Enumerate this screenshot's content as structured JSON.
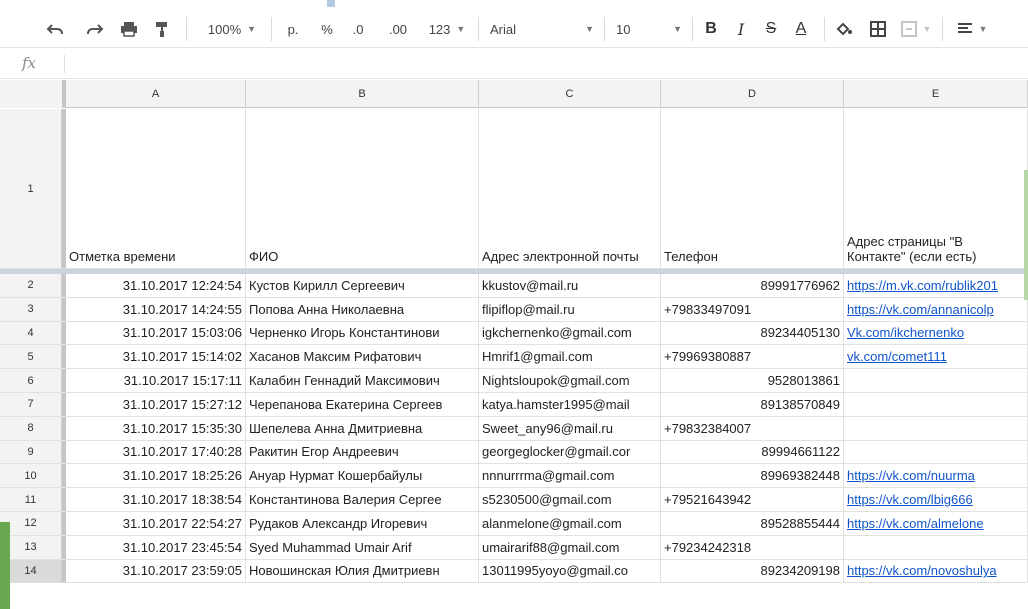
{
  "toolbar": {
    "zoom": "100%",
    "currency": "р.",
    "percent": "%",
    "dec_less": ".0",
    "dec_more": ".00",
    "more_formats": "123",
    "font": "Arial",
    "font_size": "10",
    "bold": "B",
    "italic": "I",
    "strike": "S",
    "text_color": "A"
  },
  "formula_bar": {
    "fx": "fx",
    "value": ""
  },
  "columns": [
    "A",
    "B",
    "C",
    "D",
    "E"
  ],
  "header_row": {
    "num": "1",
    "cells": [
      "Отметка времени",
      "ФИО",
      "Адрес электронной почты",
      "Телефон",
      "Адрес страницы  \"В Контакте\" (если есть)"
    ]
  },
  "rows": [
    {
      "num": "2",
      "a": "31.10.2017 12:24:54",
      "b": "Кустов Кирилл Сергеевич",
      "c": "kkustov@mail.ru",
      "d": "89991776962",
      "d_align": "right",
      "e": "https://m.vk.com/rublik201"
    },
    {
      "num": "3",
      "a": "31.10.2017 14:24:55",
      "b": "Попова Анна Николаевна",
      "c": "flipiflop@mail.ru",
      "d": "+79833497091",
      "d_align": "left",
      "e": "https://vk.com/annanicolp"
    },
    {
      "num": "4",
      "a": "31.10.2017 15:03:06",
      "b": "Черненко Игорь Константинови",
      "c": "igkchernenko@gmail.com",
      "d": "89234405130",
      "d_align": "right",
      "e": "Vk.com/ikchernenko"
    },
    {
      "num": "5",
      "a": "31.10.2017 15:14:02",
      "b": "Хасанов Максим Рифатович",
      "c": "Hmrif1@gmail.com",
      "d": "+79969380887",
      "d_align": "left",
      "e": "vk.com/comet111"
    },
    {
      "num": "6",
      "a": "31.10.2017 15:17:11",
      "b": "Калабин Геннадий Максимович",
      "c": "Nightsloupok@gmail.com",
      "d": "9528013861",
      "d_align": "right",
      "e": ""
    },
    {
      "num": "7",
      "a": "31.10.2017 15:27:12",
      "b": "Черепанова Екатерина Сергеев",
      "c": "katya.hamster1995@mail",
      "d": "89138570849",
      "d_align": "right",
      "e": ""
    },
    {
      "num": "8",
      "a": "31.10.2017 15:35:30",
      "b": "Шепелева Анна Дмитриевна",
      "c": "Sweet_any96@mail.ru",
      "d": "+79832384007",
      "d_align": "left",
      "e": ""
    },
    {
      "num": "9",
      "a": "31.10.2017 17:40:28",
      "b": "Ракитин Егор Андреевич",
      "c": "georgeglocker@gmail.cor",
      "d": "89994661122",
      "d_align": "right",
      "e": ""
    },
    {
      "num": "10",
      "a": "31.10.2017 18:25:26",
      "b": "Ануар Нурмат Кошербайулы",
      "c": "nnnurrrma@gmail.com",
      "d": "89969382448",
      "d_align": "right",
      "e": "https://vk.com/nuurma"
    },
    {
      "num": "11",
      "a": "31.10.2017 18:38:54",
      "b": "Константинова Валерия Сергее",
      "c": "s5230500@gmail.com",
      "d": "+79521643942",
      "d_align": "left",
      "e": "https://vk.com/lbig666"
    },
    {
      "num": "12",
      "a": "31.10.2017 22:54:27",
      "b": "Рудаков Александр Игоревич",
      "c": "alanmelone@gmail.com",
      "d": "89528855444",
      "d_align": "right",
      "e": "https://vk.com/almelone"
    },
    {
      "num": "13",
      "a": "31.10.2017 23:45:54",
      "b": "Syed Muhammad Umair Arif",
      "c": "umairarif88@gmail.com",
      "d": "+79234242318",
      "d_align": "left",
      "e": ""
    },
    {
      "num": "14",
      "a": "31.10.2017 23:59:05",
      "b": "Новошинская Юлия Дмитриевн",
      "c": "13011995yoyo@gmail.co",
      "d": "89234209198",
      "d_align": "right",
      "e": "https://vk.com/novoshulya"
    }
  ]
}
